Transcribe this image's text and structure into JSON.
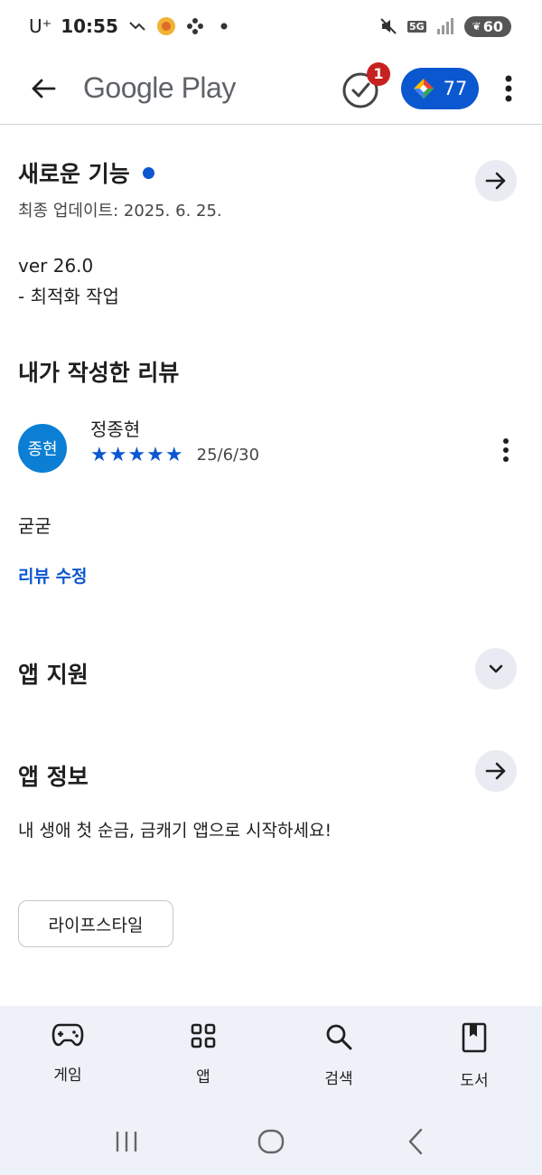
{
  "status_bar": {
    "carrier": "U⁺",
    "time": "10:55",
    "network": "5G",
    "battery": "60"
  },
  "app_bar": {
    "title": "Google Play",
    "notification_count": "1",
    "points": "77"
  },
  "whats_new": {
    "title": "새로운 기능",
    "last_updated": "최종 업데이트: 2025. 6. 25.",
    "version": "ver 26.0",
    "notes": "- 최적화 작업"
  },
  "my_review": {
    "title": "내가 작성한 리뷰",
    "avatar_text": "종현",
    "reviewer": "정종현",
    "stars": "★★★★★",
    "rating": 5,
    "date": "25/6/30",
    "text": "굳굳",
    "edit_label": "리뷰 수정"
  },
  "app_support": {
    "title": "앱 지원"
  },
  "app_info": {
    "title": "앱 정보",
    "description": "내 생애 첫 순금, 금캐기 앱으로 시작하세요!",
    "category_chip": "라이프스타일"
  },
  "bottom_nav": {
    "items": [
      {
        "label": "게임",
        "icon": "gamepad-icon"
      },
      {
        "label": "앱",
        "icon": "apps-grid-icon"
      },
      {
        "label": "검색",
        "icon": "search-icon"
      },
      {
        "label": "도서",
        "icon": "book-icon"
      }
    ]
  },
  "colors": {
    "accent": "#0b57d0",
    "badge": "#c5221f",
    "avatar": "#0b7fd4",
    "nav_bg": "#eef1f8"
  }
}
